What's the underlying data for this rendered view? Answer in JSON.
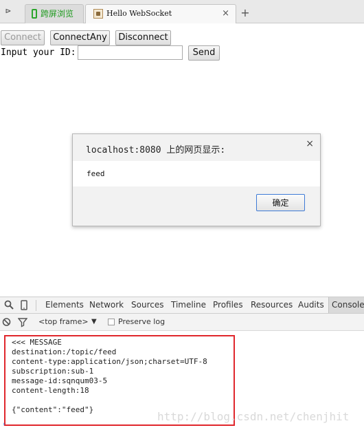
{
  "browser": {
    "sidebar_toggle_glyph": "⊳",
    "tabs": [
      {
        "label": "跨屏浏览",
        "icon": "phone-icon",
        "color": "#2ca52c"
      },
      {
        "label": "Hello WebSocket",
        "icon": "page-icon",
        "close_glyph": "×"
      }
    ],
    "new_tab_glyph": "+"
  },
  "page": {
    "buttons": {
      "connect": "Connect",
      "connect_any": "ConnectAny",
      "disconnect": "Disconnect",
      "send": "Send"
    },
    "id_label": "Input your ID:",
    "id_value": ""
  },
  "dialog": {
    "title": "localhost:8080 上的网页显示:",
    "close_glyph": "×",
    "message": "feed",
    "ok_label": "确定",
    "ok_border_color": "#3e7ad6"
  },
  "devtools": {
    "tabs": [
      "Elements",
      "Network",
      "Sources",
      "Timeline",
      "Profiles",
      "Resources",
      "Audits",
      "Console"
    ],
    "active_tab": "Console",
    "frame_selector": "<top frame>",
    "dropdown_glyph": "▼",
    "preserve_log_label": "Preserve log",
    "preserve_log_checked": false,
    "highlight_color": "#e0262b",
    "log_lines": [
      "<<< MESSAGE",
      "destination:/topic/feed",
      "content-type:application/json;charset=UTF-8",
      "subscription:sub-1",
      "message-id:sqnqum03-5",
      "content-length:18",
      "",
      "{\"content\":\"feed\"}"
    ],
    "watermark": "http://blog.csdn.net/chenjhit"
  }
}
